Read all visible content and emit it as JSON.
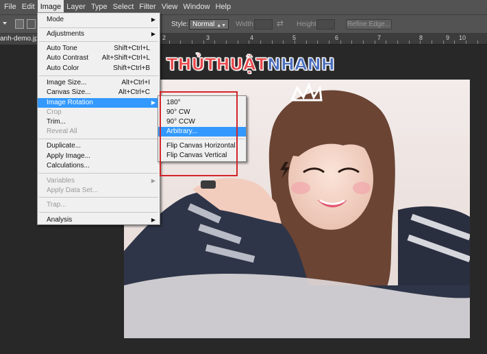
{
  "menubar": {
    "items": [
      "File",
      "Edit",
      "Image",
      "Layer",
      "Type",
      "Select",
      "Filter",
      "View",
      "Window",
      "Help"
    ],
    "active_index": 2
  },
  "options_bar": {
    "style_label": "Style:",
    "style_value": "Normal",
    "width_label": "Width:",
    "height_label": "Height:",
    "refine_edge": "Refine Edge..."
  },
  "document": {
    "tab_label": "anh-demo.jpg",
    "ruler_numbers": [
      "2",
      "3",
      "4",
      "5",
      "6",
      "7",
      "8",
      "9",
      "10"
    ]
  },
  "logo": {
    "part1": "THỦ",
    "part2": "THUẬT",
    "part3": "NHANH"
  },
  "image_menu": {
    "items": [
      {
        "label": "Mode",
        "shortcut": "",
        "submenu": true,
        "disabled": false
      },
      {
        "label": "Adjustments",
        "shortcut": "",
        "submenu": true,
        "disabled": false
      },
      {
        "label": "Auto Tone",
        "shortcut": "Shift+Ctrl+L",
        "submenu": false,
        "disabled": false
      },
      {
        "label": "Auto Contrast",
        "shortcut": "Alt+Shift+Ctrl+L",
        "submenu": false,
        "disabled": false
      },
      {
        "label": "Auto Color",
        "shortcut": "Shift+Ctrl+B",
        "submenu": false,
        "disabled": false
      },
      {
        "label": "Image Size...",
        "shortcut": "Alt+Ctrl+I",
        "submenu": false,
        "disabled": false
      },
      {
        "label": "Canvas Size...",
        "shortcut": "Alt+Ctrl+C",
        "submenu": false,
        "disabled": false
      },
      {
        "label": "Image Rotation",
        "shortcut": "",
        "submenu": true,
        "disabled": false,
        "highlighted": true
      },
      {
        "label": "Crop",
        "shortcut": "",
        "submenu": false,
        "disabled": true
      },
      {
        "label": "Trim...",
        "shortcut": "",
        "submenu": false,
        "disabled": false
      },
      {
        "label": "Reveal All",
        "shortcut": "",
        "submenu": false,
        "disabled": true
      },
      {
        "label": "Duplicate...",
        "shortcut": "",
        "submenu": false,
        "disabled": false
      },
      {
        "label": "Apply Image...",
        "shortcut": "",
        "submenu": false,
        "disabled": false
      },
      {
        "label": "Calculations...",
        "shortcut": "",
        "submenu": false,
        "disabled": false
      },
      {
        "label": "Variables",
        "shortcut": "",
        "submenu": true,
        "disabled": true
      },
      {
        "label": "Apply Data Set...",
        "shortcut": "",
        "submenu": false,
        "disabled": true
      },
      {
        "label": "Trap...",
        "shortcut": "",
        "submenu": false,
        "disabled": true
      },
      {
        "label": "Analysis",
        "shortcut": "",
        "submenu": true,
        "disabled": false
      }
    ]
  },
  "rotation_submenu": {
    "items": [
      {
        "label": "180°",
        "highlighted": false
      },
      {
        "label": "90° CW",
        "highlighted": false
      },
      {
        "label": "90° CCW",
        "highlighted": false
      },
      {
        "label": "Arbitrary...",
        "highlighted": true
      },
      {
        "label": "Flip Canvas Horizontal",
        "highlighted": false
      },
      {
        "label": "Flip Canvas Vertical",
        "highlighted": false
      }
    ]
  },
  "colors": {
    "highlight": "#3399ff",
    "annotation_box": "#d2232a",
    "logo_red": "#e8474a",
    "logo_blue": "#4b6fbf"
  }
}
